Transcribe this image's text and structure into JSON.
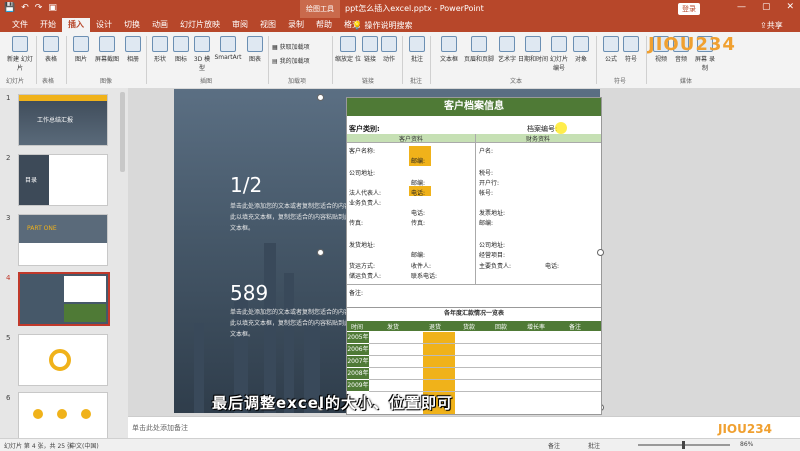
{
  "titlebar": {
    "context_tab": "绘图工具",
    "doc_title": "ppt怎么插入excel.pptx - PowerPoint",
    "login": "登录",
    "min": "—",
    "max": "▢",
    "close": "✕"
  },
  "menu": {
    "tabs": [
      "文件",
      "开始",
      "插入",
      "设计",
      "切换",
      "动画",
      "幻灯片放映",
      "审阅",
      "视图",
      "录制",
      "帮助",
      "格式"
    ],
    "search": "操作说明搜索",
    "share": "共享"
  },
  "ribbon": {
    "buttons": [
      "新建\n幻灯片",
      "表格",
      "图片",
      "屏幕截图",
      "相册",
      "形状",
      "图标",
      "3D\n模型",
      "SmartArt",
      "图表",
      "缩放定\n位",
      "链接",
      "动作",
      "批注",
      "文本框",
      "页眉和页脚",
      "艺术字",
      "日期和时间",
      "幻灯片\n编号",
      "对象",
      "公式",
      "符号",
      "视频",
      "音频",
      "屏幕\n录制"
    ],
    "side": [
      "获取加载项",
      "我的加载项"
    ],
    "groups": [
      "幻灯片",
      "表格",
      "图像",
      "插图",
      "加载项",
      "链接",
      "批注",
      "文本",
      "符号",
      "媒体"
    ]
  },
  "logo": "JIOU234",
  "thumbs": [
    {
      "num": "1",
      "title": "工作总结汇报"
    },
    {
      "num": "2",
      "title": "目录"
    },
    {
      "num": "3",
      "title": "PART ONE"
    },
    {
      "num": "4"
    },
    {
      "num": "5"
    },
    {
      "num": "6"
    }
  ],
  "slide": {
    "num1": "1/2",
    "desc1": "单击此处添加您的文本或者复制您适合的内容粘贴到此以填充文本框，复制您适合的内容粘贴到此以填充文本框。",
    "num2": "589",
    "desc2": "单击此处添加您的文本或者复制您适合的内容粘贴到此以填充文本框，复制您适合的内容粘贴到此以填充文本框。"
  },
  "sheet": {
    "title": "客户档案信息",
    "customer_type": "客户类别:",
    "archive_no": "档案编号:",
    "left_header": "客户资料",
    "right_header": "财务资料",
    "left_rows": [
      "客户名称:",
      "邮编:",
      "公司地址:",
      "邮编:",
      "法人代表人:",
      "电话:",
      "业务负责人:",
      "电话:",
      "传真:",
      "传真:",
      "发货地址:",
      "邮编:",
      "货运方式:",
      "收件人:",
      "储运负责人:",
      "联系电话:",
      "备注:"
    ],
    "right_rows": [
      "户名:",
      "税号:",
      "开户行:",
      "帐号:",
      "发票地址:",
      "邮编:",
      "公司地址:",
      "经营项目:",
      "主要负责人:",
      "电话:"
    ]
  },
  "table2": {
    "title": "各年度汇款情况一览表",
    "cols": [
      "时间",
      "发货",
      "退货",
      "货款",
      "回款",
      "增长率",
      "备注"
    ],
    "years": [
      "2005年",
      "2006年",
      "2007年",
      "2008年",
      "2009年"
    ]
  },
  "subtitle": "最后调整excel的大小、位置即可",
  "notes": "单击此处添加备注",
  "status": {
    "slide_info": "幻灯片 第 4 张，共 25 张",
    "lang": "中文(中国)",
    "notes_btn": "备注",
    "comments_btn": "批注",
    "zoom": "86%"
  },
  "colors": {
    "accent": "#b7472a",
    "sheet_green": "#4f7a36",
    "sheet_light_green": "#c6e0b4",
    "highlight_yellow": "#f0b21a"
  }
}
